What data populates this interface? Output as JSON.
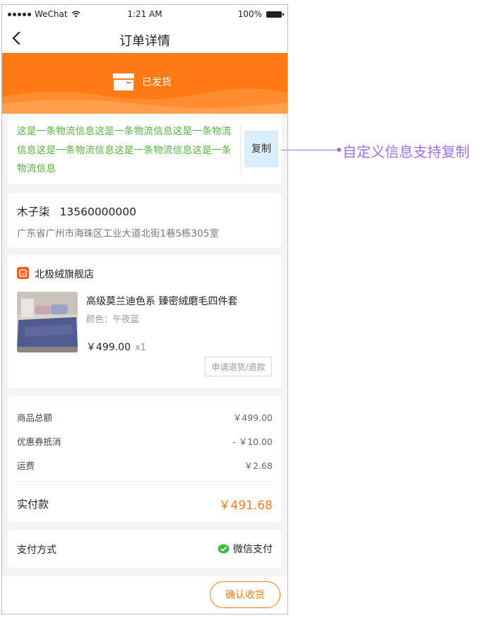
{
  "status_bar": {
    "carrier": "WeChat",
    "time": "1:21 AM",
    "battery": "100%"
  },
  "nav": {
    "title": "订单详情"
  },
  "banner": {
    "status_text": "已发货",
    "color": "#ff7a14"
  },
  "logistics": {
    "text": "这是一条物流信息这是一条物流信息这是一条物流信息这是一条物流信息这是一条物流信息这是一条物流信息",
    "copy_label": "复制",
    "text_color": "#52b43a"
  },
  "address": {
    "name": "木子柒",
    "phone": "13560000000",
    "detail": "广东省广州市海珠区工业大道北街1巷5栋305室"
  },
  "shop": {
    "name": "北极绒旗舰店"
  },
  "product": {
    "name": "高级莫兰迪色系  臻密绒磨毛四件套",
    "spec": "颜色：午夜蓝",
    "price": "￥499.00",
    "qty": "x1",
    "refund_label": "申请退货/退款"
  },
  "summary": {
    "rows": [
      {
        "label": "商品总额",
        "value": "￥499.00"
      },
      {
        "label": "优惠券抵消",
        "value": "- ￥10.00"
      },
      {
        "label": "运费",
        "value": "￥2.68"
      }
    ],
    "total_label": "实付款",
    "total_value": "￥491.68"
  },
  "payment": {
    "label": "支付方式",
    "method": "微信支付"
  },
  "footer": {
    "confirm_label": "确认收货"
  },
  "annotation": {
    "text": "自定义信息支持复制",
    "color": "#a06df2"
  },
  "icons": [
    "back-icon",
    "delivery-box-icon",
    "shop-icon",
    "wechat-pay-icon",
    "signal-icon",
    "wifi-icon",
    "battery-icon"
  ]
}
